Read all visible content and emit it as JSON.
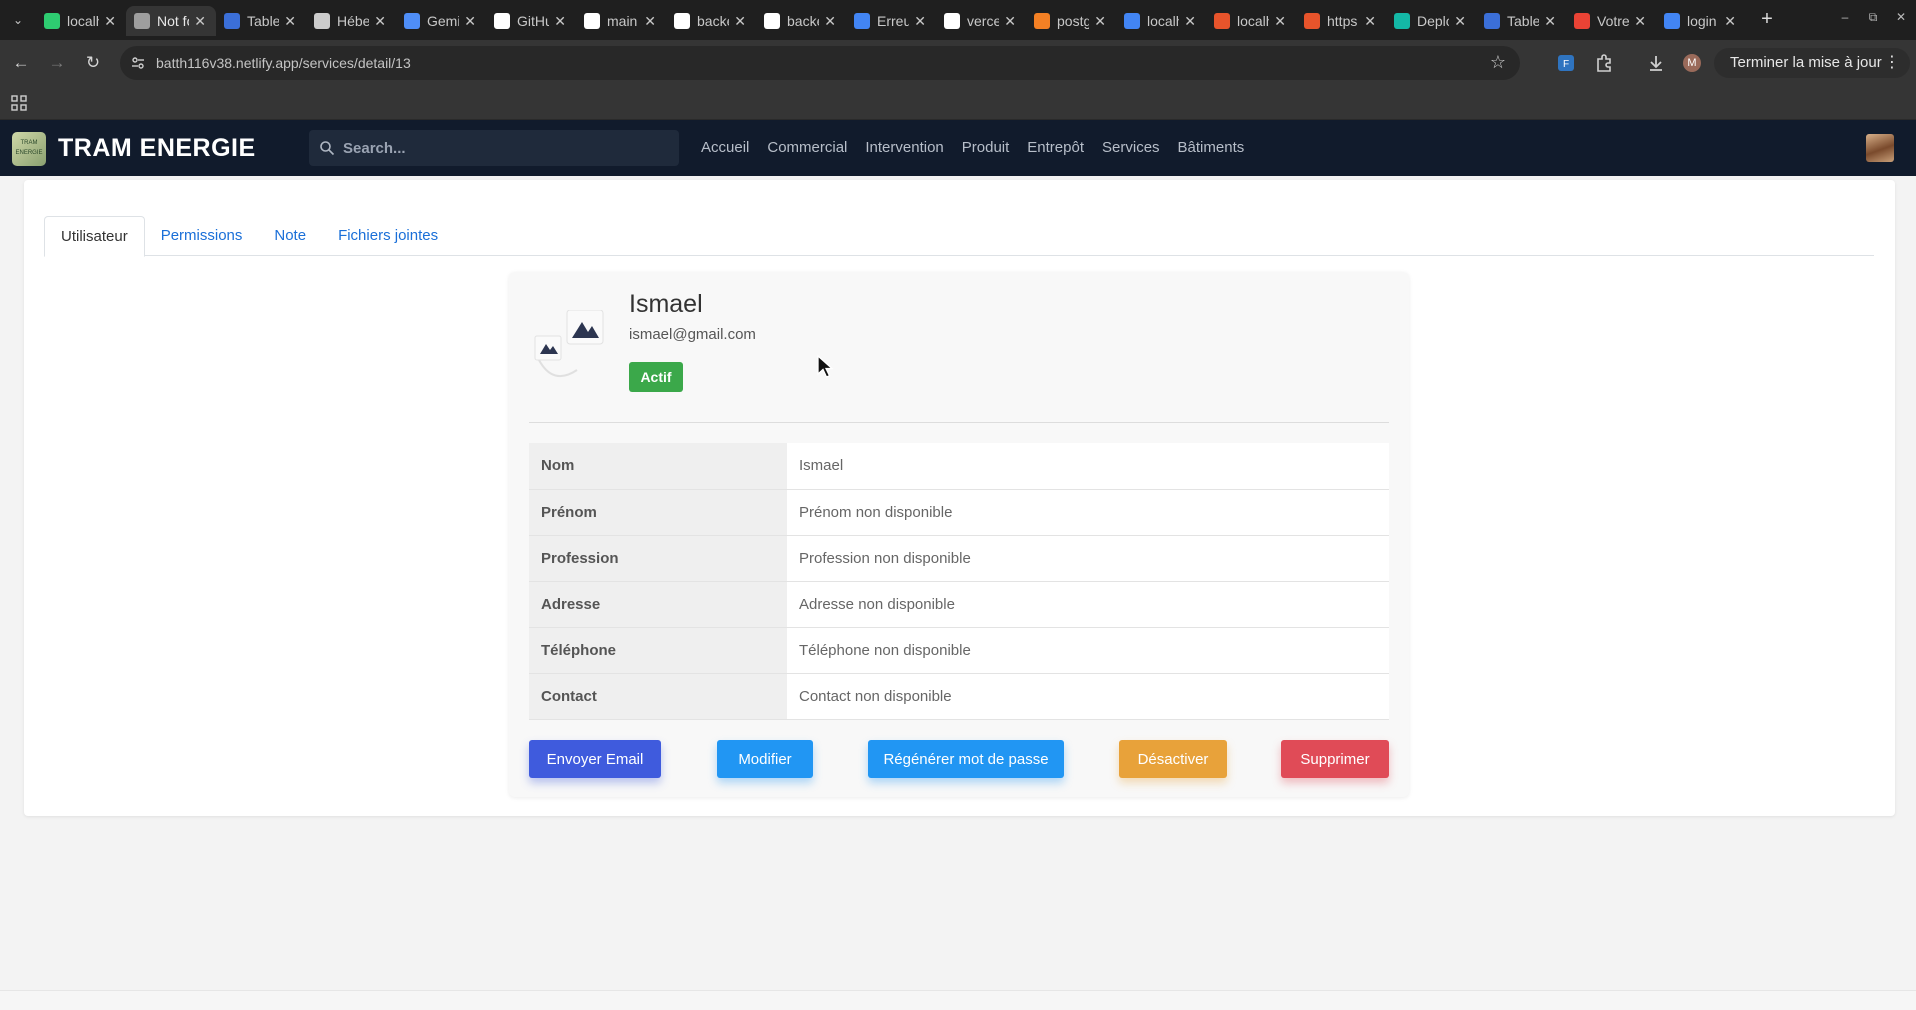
{
  "browser": {
    "tabs": [
      {
        "title": "localhost",
        "icon": "triangle-green-icon",
        "color": "#2ecc71"
      },
      {
        "title": "Not found",
        "icon": "globe-icon",
        "color": "#9e9e9e"
      },
      {
        "title": "Tableau",
        "icon": "tableau-icon",
        "color": "#3b6fd8"
      },
      {
        "title": "Hébergement",
        "icon": "openai-icon",
        "color": "#cccccc"
      },
      {
        "title": "Gemini",
        "icon": "gemini-icon",
        "color": "#4f8ef7"
      },
      {
        "title": "GitHub",
        "icon": "github-icon",
        "color": "#ffffff"
      },
      {
        "title": "main",
        "icon": "github-icon",
        "color": "#ffffff"
      },
      {
        "title": "backend",
        "icon": "vercel-icon",
        "color": "#ffffff"
      },
      {
        "title": "backend",
        "icon": "vercel-icon",
        "color": "#ffffff"
      },
      {
        "title": "Erreur",
        "icon": "google-icon",
        "color": "#4285f4"
      },
      {
        "title": "vercel",
        "icon": "github-icon",
        "color": "#ffffff"
      },
      {
        "title": "postgres",
        "icon": "stackoverflow-icon",
        "color": "#f48024"
      },
      {
        "title": "localhost",
        "icon": "google-icon",
        "color": "#4285f4"
      },
      {
        "title": "localhost",
        "icon": "codeigniter-icon",
        "color": "#e8542b"
      },
      {
        "title": "https",
        "icon": "codeigniter-icon",
        "color": "#e8542b"
      },
      {
        "title": "Deploy",
        "icon": "diamond-icon",
        "color": "#14b8a6"
      },
      {
        "title": "Tableau",
        "icon": "tableau-icon",
        "color": "#3b6fd8"
      },
      {
        "title": "Votre",
        "icon": "gmail-icon",
        "color": "#ea4335"
      },
      {
        "title": "login",
        "icon": "google-icon",
        "color": "#4285f4"
      }
    ],
    "active_tab_index": 1,
    "url": "batth116v38.netlify.app/services/detail/13",
    "update_label": "Terminer la mise à jour",
    "profile_initial": "M"
  },
  "app": {
    "brand": "TRAM ENERGIE",
    "logo_text": "TRAM ENERGIE",
    "search_placeholder": "Search...",
    "menu": [
      "Accueil",
      "Commercial",
      "Intervention",
      "Produit",
      "Entrepôt",
      "Services",
      "Bâtiments"
    ]
  },
  "tabs": {
    "items": [
      "Utilisateur",
      "Permissions",
      "Note",
      "Fichiers jointes"
    ],
    "active": "Utilisateur"
  },
  "user": {
    "name": "Ismael",
    "email": "ismael@gmail.com",
    "status": "Actif",
    "status_color": "#3ba84a"
  },
  "details": [
    {
      "label": "Nom",
      "value": "Ismael"
    },
    {
      "label": "Prénom",
      "value": "Prénom non disponible"
    },
    {
      "label": "Profession",
      "value": "Profession non disponible"
    },
    {
      "label": "Adresse",
      "value": "Adresse non disponible"
    },
    {
      "label": "Téléphone",
      "value": "Téléphone non disponible"
    },
    {
      "label": "Contact",
      "value": "Contact non disponible"
    }
  ],
  "actions": {
    "email": "Envoyer Email",
    "edit": "Modifier",
    "regen": "Régénérer mot de passe",
    "deactivate": "Désactiver",
    "delete": "Supprimer"
  }
}
